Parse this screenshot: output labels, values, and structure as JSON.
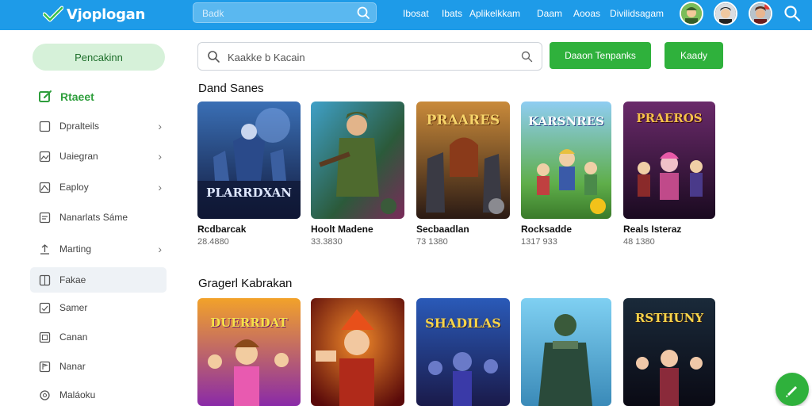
{
  "brand": {
    "name": "Vjoplogan",
    "accent": "#1e9be8",
    "green": "#2fb13c"
  },
  "topbar": {
    "search_placeholder": "Ваdk",
    "nav": [
      "Ibosat",
      "Ibats",
      "Aplikelkkam",
      "Daam",
      "Aooas",
      "Divilidsagam"
    ]
  },
  "sidebar": {
    "pill_label": "Pencakinn",
    "active_label": "Rtaeet",
    "items": [
      {
        "label": "Dpralteils",
        "icon": "square-icon",
        "chevron": true
      },
      {
        "label": "Uaiegran",
        "icon": "image-icon",
        "chevron": true
      },
      {
        "label": "Eaploy",
        "icon": "mountain-icon",
        "chevron": true
      },
      {
        "label": "Nanarlats Sáme",
        "icon": "list-icon",
        "chevron": false
      },
      {
        "label": "Marting",
        "icon": "upload-icon",
        "chevron": true
      },
      {
        "label": "Fakae",
        "icon": "grid-icon",
        "chevron": false,
        "selected": true
      },
      {
        "label": "Samer",
        "icon": "check-icon",
        "chevron": false
      },
      {
        "label": "Canan",
        "icon": "box-icon",
        "chevron": false
      },
      {
        "label": "Nanar",
        "icon": "flag-icon",
        "chevron": false
      },
      {
        "label": "Maláoku",
        "icon": "gear-icon",
        "chevron": false
      }
    ]
  },
  "main": {
    "search_placeholder": "Kaakke b Kacain",
    "primary_button": "Daaon Tenpanks",
    "secondary_button": "Kaady",
    "section1_title": "Dand Sanes",
    "section2_title": "Gragerl Kabrakan",
    "games_row1": [
      {
        "title": "Rcdbarcak",
        "sub": "28.4880",
        "art_text": "PLARRDXAN"
      },
      {
        "title": "Hoolt Madene",
        "sub": "33.3830",
        "art_text": ""
      },
      {
        "title": "Secbaadlan",
        "sub": "73 1380",
        "art_text": "PRAARES"
      },
      {
        "title": "Rocksadde",
        "sub": "1317 933",
        "art_text": "KARSNRES"
      },
      {
        "title": "Reals Isteraz",
        "sub": "48 1380",
        "art_text": "PRAEROS"
      }
    ],
    "games_row2": [
      {
        "art_text": "DUERRDAT"
      },
      {
        "art_text": ""
      },
      {
        "art_text": "SHADILAS"
      },
      {
        "art_text": ""
      },
      {
        "art_text": "RSTHUNY"
      }
    ]
  }
}
